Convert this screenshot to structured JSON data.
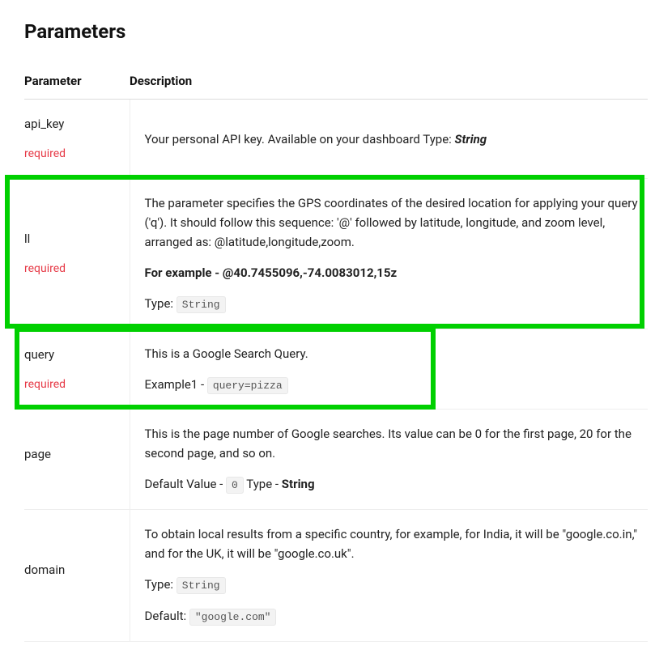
{
  "section": {
    "title": "Parameters",
    "columns": {
      "param": "Parameter",
      "desc": "Description"
    }
  },
  "rows": {
    "api_key": {
      "name": "api_key",
      "required": "required",
      "desc": "Your personal API key. Available on your dashboard Type: ",
      "type_suffix": "String"
    },
    "ll": {
      "name": "ll",
      "required": "required",
      "desc": "The parameter specifies the GPS coordinates of the desired location for applying your query ('q'). It should follow this sequence: '@' followed by latitude, longitude, and zoom level, arranged as: @latitude,longitude,zoom.",
      "example_label": "For example - ",
      "example_value": "@40.7455096,-74.0083012,15z",
      "type_label": "Type: ",
      "type_code": "String"
    },
    "query": {
      "name": "query",
      "required": "required",
      "desc": "This is a Google Search Query.",
      "example_label": "Example1 - ",
      "example_code": "query=pizza"
    },
    "page": {
      "name": "page",
      "desc": "This is the page number of Google searches. Its value can be 0 for the first page, 20 for the second page, and so on.",
      "default_label": "Default Value - ",
      "default_code": "0",
      "type_label": " Type - ",
      "type_strong": "String"
    },
    "domain": {
      "name": "domain",
      "desc": "To obtain local results from a specific country, for example, for India, it will be \"google.co.in,\" and for the UK, it will be \"google.co.uk\".",
      "type_label": "Type: ",
      "type_code": "String",
      "default_label": "Default: ",
      "default_code": "\"google.com\""
    }
  }
}
